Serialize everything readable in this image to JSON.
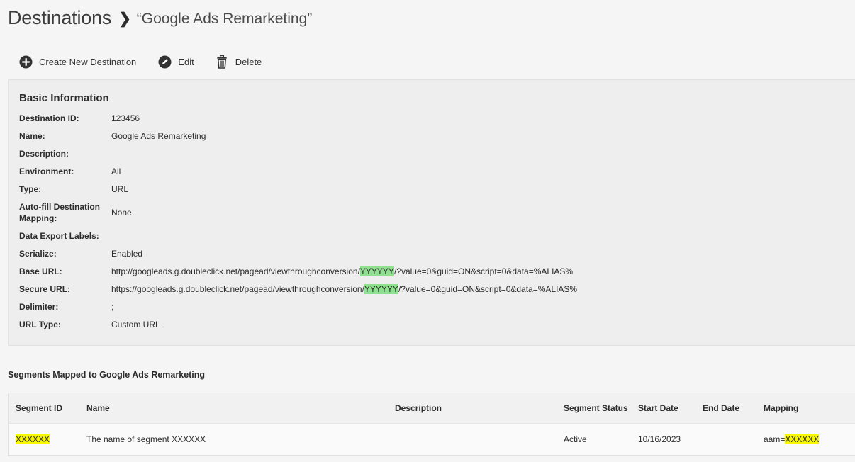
{
  "header": {
    "breadcrumb_root": "Destinations",
    "current": "“Google Ads Remarketing”"
  },
  "toolbar": {
    "create_label": "Create New Destination",
    "edit_label": "Edit",
    "delete_label": "Delete"
  },
  "basic_info": {
    "title": "Basic Information",
    "rows": [
      {
        "label": "Destination ID:",
        "value": "123456"
      },
      {
        "label": "Name:",
        "value": "Google Ads Remarketing"
      },
      {
        "label": "Description:",
        "value": ""
      },
      {
        "label": "Environment:",
        "value": "All"
      },
      {
        "label": "Type:",
        "value": "URL"
      },
      {
        "label": "Auto-fill Destination Mapping:",
        "value": "None"
      },
      {
        "label": "Data Export Labels:",
        "value": ""
      },
      {
        "label": "Serialize:",
        "value": "Enabled"
      },
      {
        "label": "Base URL:",
        "value_prefix": "http://googleads.g.doubleclick.net/pagead/viewthroughconversion/",
        "value_highlight": "YYYYYY",
        "value_suffix": "/?value=0&guid=ON&script=0&data=%ALIAS%"
      },
      {
        "label": "Secure URL:",
        "value_prefix": "https://googleads.g.doubleclick.net/pagead/viewthroughconversion/",
        "value_highlight": "YYYYYY",
        "value_suffix": "/?value=0&guid=ON&script=0&data=%ALIAS%"
      },
      {
        "label": "Delimiter:",
        "value": ";"
      },
      {
        "label": "URL Type:",
        "value": "Custom URL"
      }
    ]
  },
  "segments": {
    "title": "Segments Mapped to Google Ads Remarketing",
    "columns": [
      "Segment ID",
      "Name",
      "Description",
      "Segment Status",
      "Start Date",
      "End Date",
      "Mapping"
    ],
    "rows": [
      {
        "segment_id": "XXXXXX",
        "name": "The name of segment XXXXXX",
        "description": "",
        "status": "Active",
        "start_date": "10/16/2023",
        "end_date": "",
        "mapping_prefix": "aam=",
        "mapping_highlight": "XXXXXX"
      }
    ]
  },
  "colors": {
    "highlight_green": "#8fe08f",
    "highlight_yellow": "#f7f700"
  }
}
